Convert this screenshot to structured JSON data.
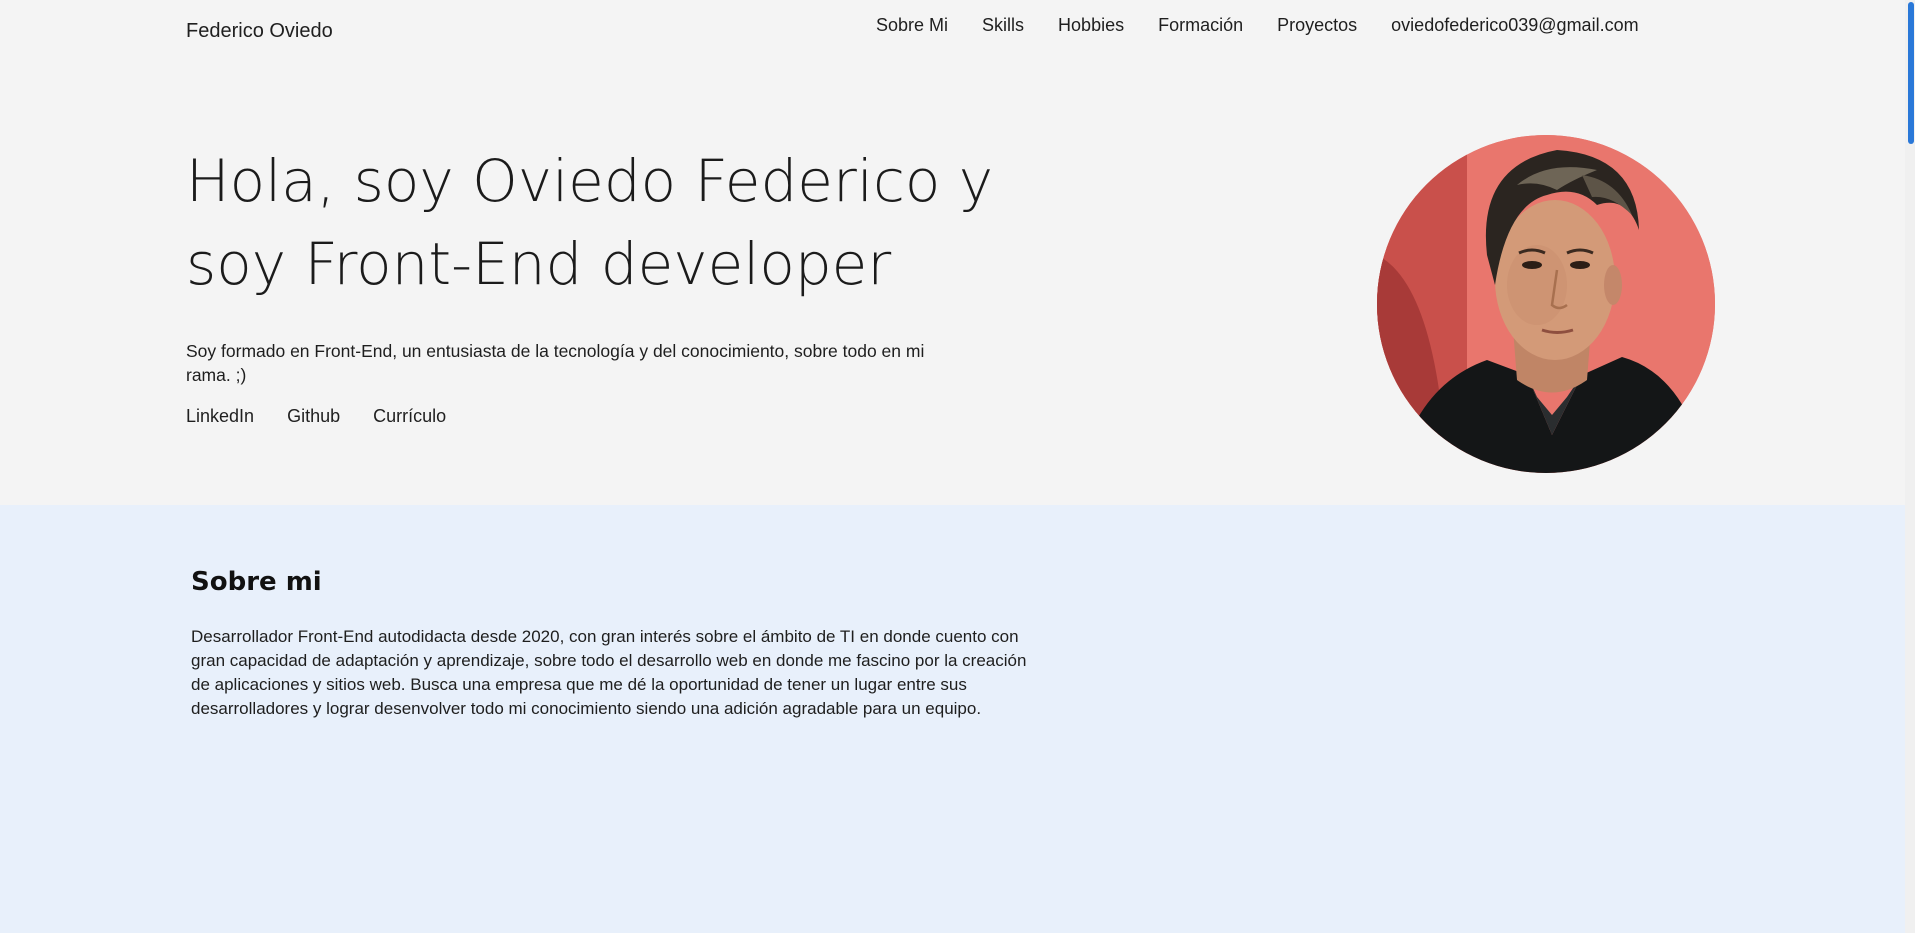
{
  "header": {
    "brand": "Federico Oviedo",
    "nav": [
      {
        "label": "Sobre Mi"
      },
      {
        "label": "Skills"
      },
      {
        "label": "Hobbies"
      },
      {
        "label": "Formación"
      },
      {
        "label": "Proyectos"
      },
      {
        "label": "oviedofederico039@gmail.com"
      }
    ]
  },
  "hero": {
    "title": "Hola, soy Oviedo Federico y soy Front-End developer",
    "description": "Soy formado en Front-End, un entusiasta de la tecnología y del conocimiento, sobre todo en mi rama. ;)",
    "links": [
      {
        "label": "LinkedIn"
      },
      {
        "label": "Github"
      },
      {
        "label": "Currículo"
      }
    ],
    "avatar_icon": "profile-photo"
  },
  "about": {
    "title": "Sobre mi",
    "text": "Desarrollador Front-End autodidacta desde 2020, con gran interés sobre el ámbito de TI en donde cuento con gran capacidad de adaptación y aprendizaje, sobre todo el desarrollo web en donde me fascino por la creación de aplicaciones y sitios web. Busca una empresa que me dé la oportunidad de tener un lugar entre sus desarrolladores y lograr desenvolver todo mi conocimiento siendo una adición agradable para un equipo."
  },
  "colors": {
    "page_bg": "#f4f4f4",
    "about_bg": "#e8f0fb",
    "scroll_thumb": "#2a78d8",
    "avatar_bg": "#e2736c"
  }
}
